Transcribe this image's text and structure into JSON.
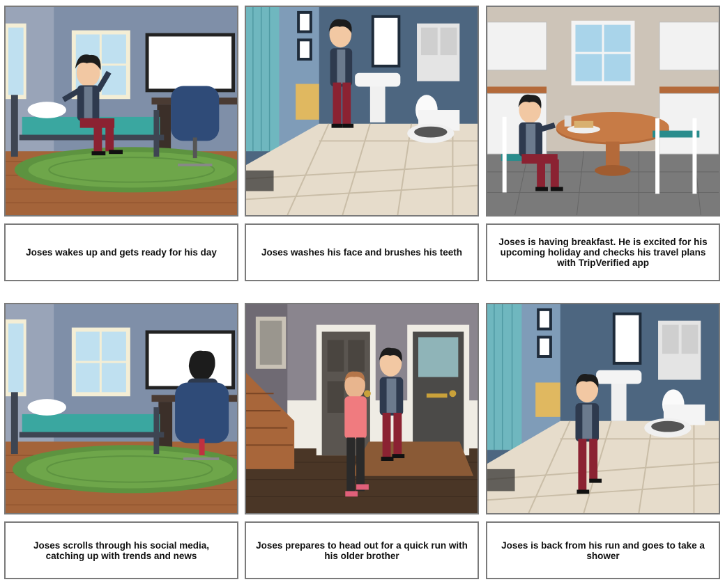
{
  "storyboard": {
    "panels": [
      {
        "scene": "bedroom",
        "caption": "Joses wakes up and gets ready for his day"
      },
      {
        "scene": "bathroom",
        "caption": "Joses washes his face and brushes his teeth"
      },
      {
        "scene": "kitchen",
        "caption": "Joses is having breakfast. He is excited for his upcoming holiday and checks his travel plans with TripVerified app"
      },
      {
        "scene": "bedroom-desk",
        "caption": "Joses scrolls through his social media, catching up with trends and news"
      },
      {
        "scene": "hallway",
        "caption": "Joses prepares to head out for a quick run with his older brother"
      },
      {
        "scene": "bathroom",
        "caption": "Joses is back from his run and goes to take a shower"
      }
    ]
  },
  "colors": {
    "shirt": "#c04a57",
    "jacket": "#2e3a4e",
    "pants": "#8b2232",
    "rug": "#6ea64a",
    "wall_bedroom": "#7f8fa8",
    "wall_bathroom": "#4d6680",
    "floor_tile": "#e6dccb"
  }
}
